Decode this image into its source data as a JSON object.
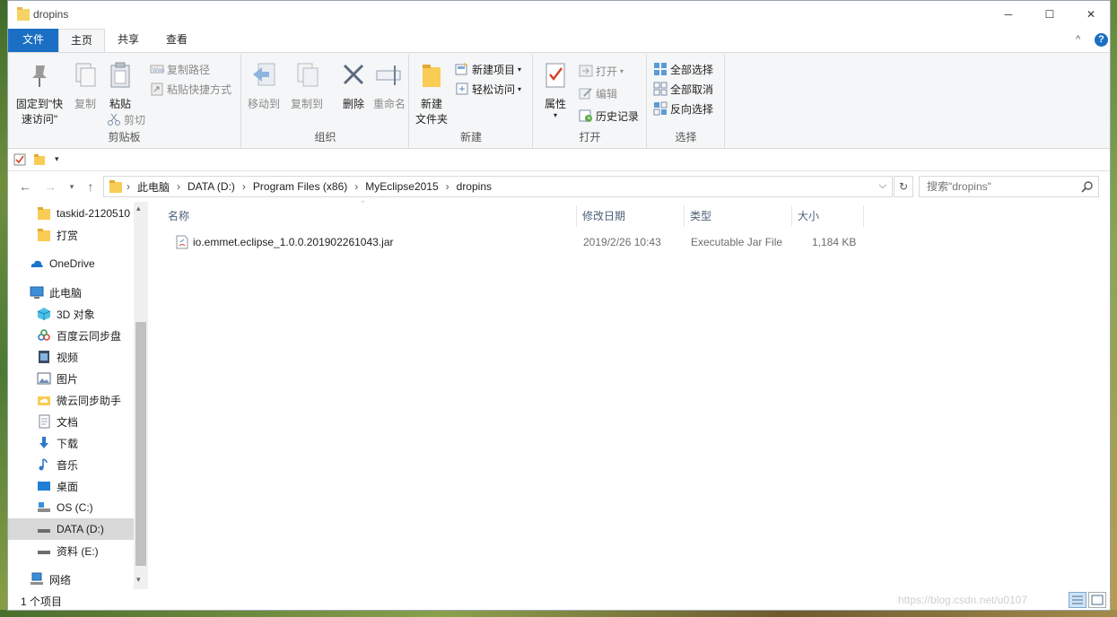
{
  "window": {
    "title": "dropins",
    "controls": {
      "minimize": "─",
      "maximize": "☐",
      "close": "✕"
    }
  },
  "ribbon_tabs": [
    {
      "label": "文件"
    },
    {
      "label": "主页"
    },
    {
      "label": "共享"
    },
    {
      "label": "查看"
    }
  ],
  "ribbon_ctrl": {
    "collapse": "^",
    "help": "?"
  },
  "ribbon": {
    "clipboard": {
      "label": "剪贴板",
      "pin": "固定到\"快速访问\"",
      "pin_line1": "固定到\"快",
      "pin_line2": "速访问\"",
      "copy": "复制",
      "paste": "粘贴",
      "copy_path": "复制路径",
      "paste_shortcut": "粘贴快捷方式",
      "cut": "剪切"
    },
    "organize": {
      "label": "组织",
      "move_to": "移动到",
      "copy_to": "复制到",
      "delete": "删除",
      "rename": "重命名"
    },
    "new": {
      "label": "新建",
      "new_folder_line1": "新建",
      "new_folder_line2": "文件夹",
      "new_item": "新建项目",
      "easy_access": "轻松访问"
    },
    "open": {
      "label": "打开",
      "properties": "属性",
      "open": "打开",
      "edit": "编辑",
      "history": "历史记录"
    },
    "select": {
      "label": "选择",
      "select_all": "全部选择",
      "select_none": "全部取消",
      "invert": "反向选择"
    }
  },
  "address": {
    "crumbs": [
      "此电脑",
      "DATA (D:)",
      "Program Files (x86)",
      "MyEclipse2015",
      "dropins"
    ],
    "search_placeholder": "搜索\"dropins\""
  },
  "nav_pane": {
    "items": [
      {
        "label": "taskid-2120510",
        "icon": "folder-icon",
        "indent": 1
      },
      {
        "label": "打赏",
        "icon": "folder-icon",
        "indent": 1
      },
      {
        "label": "OneDrive",
        "icon": "onedrive-icon",
        "indent": 0
      },
      {
        "label": "此电脑",
        "icon": "pc-icon",
        "indent": 0
      },
      {
        "label": "3D 对象",
        "icon": "3d-objects-icon",
        "indent": 1
      },
      {
        "label": "百度云同步盘",
        "icon": "baidu-cloud-icon",
        "indent": 1
      },
      {
        "label": "视频",
        "icon": "video-icon",
        "indent": 1
      },
      {
        "label": "图片",
        "icon": "pictures-icon",
        "indent": 1
      },
      {
        "label": "微云同步助手",
        "icon": "weiyun-icon",
        "indent": 1
      },
      {
        "label": "文档",
        "icon": "documents-icon",
        "indent": 1
      },
      {
        "label": "下载",
        "icon": "downloads-icon",
        "indent": 1
      },
      {
        "label": "音乐",
        "icon": "music-icon",
        "indent": 1
      },
      {
        "label": "桌面",
        "icon": "desktop-icon",
        "indent": 1
      },
      {
        "label": "OS (C:)",
        "icon": "drive-c-icon",
        "indent": 1
      },
      {
        "label": "DATA (D:)",
        "icon": "drive-d-icon",
        "indent": 1,
        "selected": true
      },
      {
        "label": "资料 (E:)",
        "icon": "drive-e-icon",
        "indent": 1
      },
      {
        "label": "网络",
        "icon": "network-icon",
        "indent": 0
      }
    ]
  },
  "file_list": {
    "columns": [
      "名称",
      "修改日期",
      "类型",
      "大小"
    ],
    "rows": [
      {
        "name": "io.emmet.eclipse_1.0.0.201902261043.jar",
        "modified": "2019/2/26 10:43",
        "type": "Executable Jar File",
        "size": "1,184 KB"
      }
    ]
  },
  "status": {
    "count": "1 个项目",
    "watermark": "https://blog.csdn.net/u0107"
  },
  "colors": {
    "accent": "#1a6fc4",
    "selected_row": "#d9d9d9",
    "header_text": "#4c607a"
  }
}
